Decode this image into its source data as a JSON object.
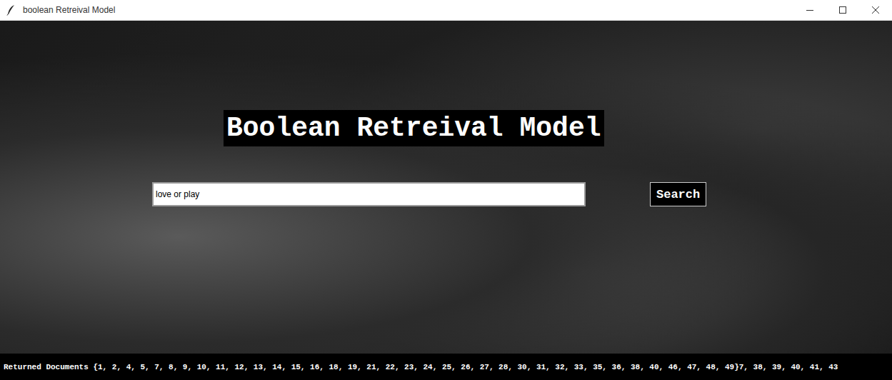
{
  "window": {
    "title": "boolean Retreival Model"
  },
  "heading": "Boolean Retreival Model",
  "search": {
    "value": "love or play"
  },
  "button": "Search",
  "results": "Returned Documents {1, 2, 4, 5, 7, 8, 9, 10, 11, 12, 13, 14, 15, 16, 18, 19, 21, 22, 23, 24, 25, 26, 27, 28, 30, 31, 32, 33, 35, 36, 38, 40, 46, 47, 48, 49}7, 38, 39, 40, 41, 43"
}
